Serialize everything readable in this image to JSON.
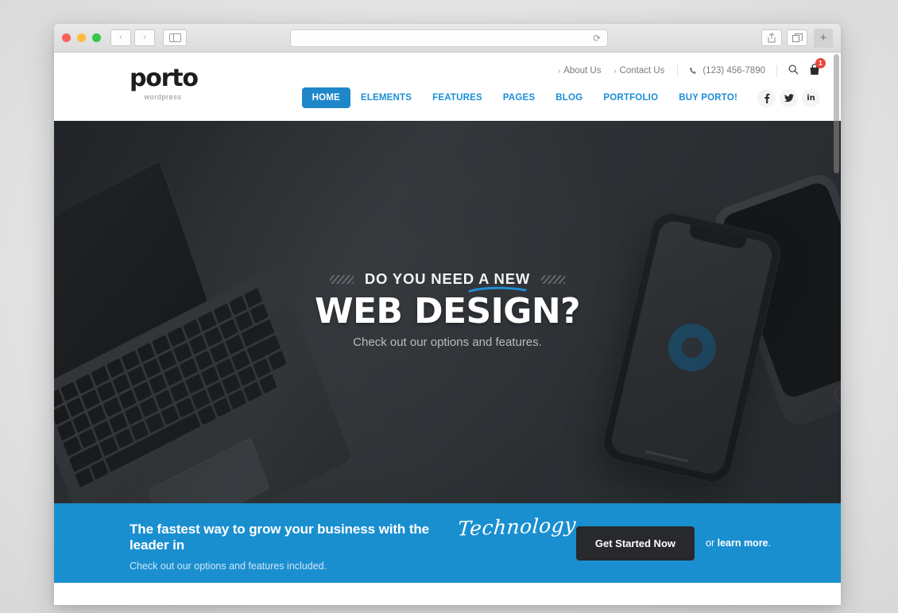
{
  "browser": {
    "name": "safari",
    "traffic_lights": [
      "close",
      "minimize",
      "zoom"
    ],
    "back_label": "‹",
    "forward_label": "›",
    "sidebar_icon": "sidebar-icon",
    "url_value": "",
    "url_placeholder": "",
    "reload_icon": "⟳",
    "share_icon": "share-icon",
    "tabs_icon": "tabs-icon",
    "new_tab_label": "+"
  },
  "site": {
    "logo": {
      "word": "porto",
      "subtitle": "wordpress"
    },
    "topbar": {
      "links": [
        {
          "label": "About Us",
          "chevron": "›"
        },
        {
          "label": "Contact Us",
          "chevron": "›"
        }
      ],
      "phone": "(123) 456-7890",
      "phone_icon": "phone-icon",
      "search_icon": "search-icon",
      "cart_icon": "cart-icon",
      "cart_count": "1"
    },
    "nav": [
      {
        "label": "HOME",
        "active": true
      },
      {
        "label": "ELEMENTS",
        "active": false
      },
      {
        "label": "FEATURES",
        "active": false
      },
      {
        "label": "PAGES",
        "active": false
      },
      {
        "label": "BLOG",
        "active": false
      },
      {
        "label": "PORTFOLIO",
        "active": false
      },
      {
        "label": "BUY PORTO!",
        "active": false
      }
    ],
    "social": [
      {
        "name": "facebook",
        "glyph": "f"
      },
      {
        "name": "twitter",
        "glyph": "ᴠ"
      },
      {
        "name": "linkedin",
        "glyph": "in"
      }
    ],
    "hero": {
      "eyebrow": "DO YOU NEED A NEW",
      "headline": "WEB DESIGN?",
      "subline": "Check out our options and features."
    },
    "cta": {
      "title_lead": "The fastest way to grow your business with the leader in",
      "title_script": "Technology",
      "subtitle": "Check out our options and features included.",
      "button_label": "Get Started Now",
      "or_prefix": "or ",
      "link_label": "learn more",
      "or_suffix": "."
    }
  },
  "colors": {
    "accent_blue": "#1a8fd0",
    "nav_blue": "#1e87c9",
    "badge_red": "#e8483c",
    "hero_dark": "#303438",
    "button_dark": "#27292c"
  }
}
